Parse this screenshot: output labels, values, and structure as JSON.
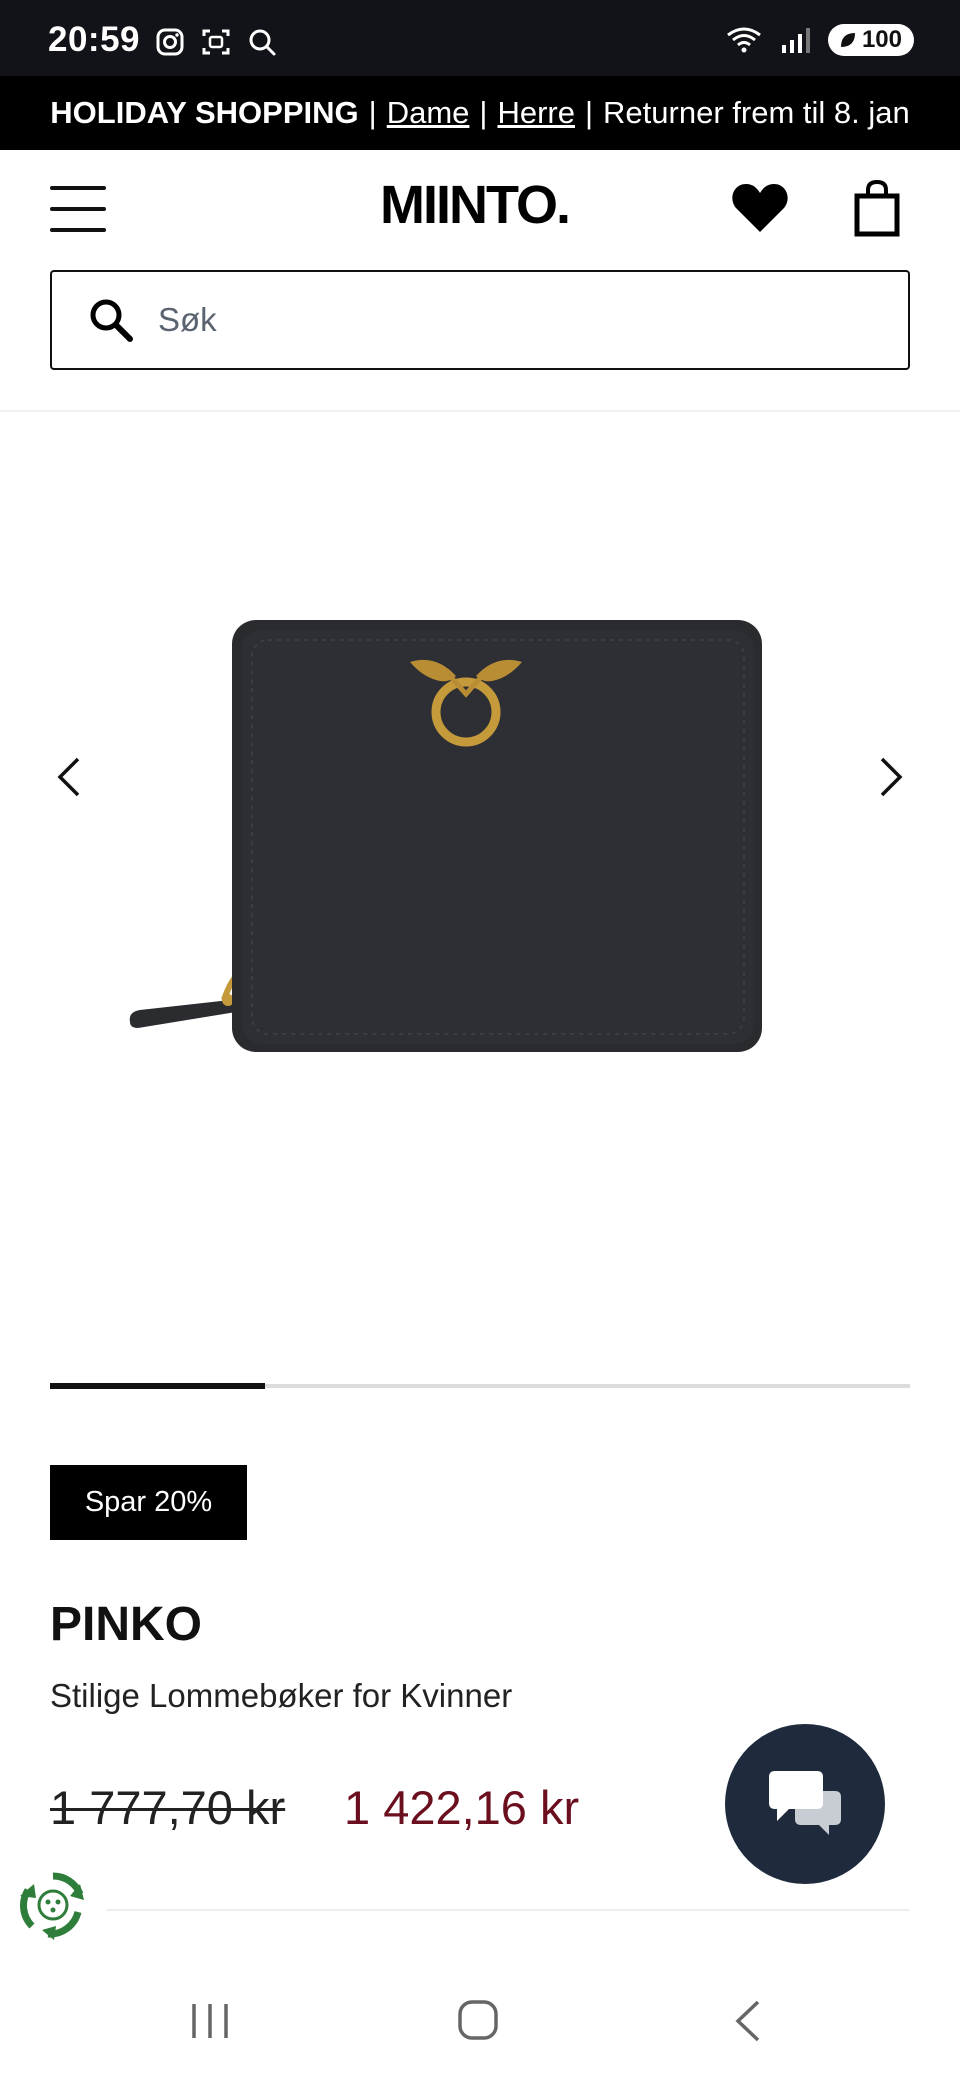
{
  "status_bar": {
    "time": "20:59",
    "left_icons": [
      "instagram-icon",
      "screenshot-icon",
      "search-icon"
    ],
    "right_icons": [
      "wifi-icon",
      "signal-icon"
    ],
    "battery": "100"
  },
  "promo": {
    "headline": "HOLIDAY SHOPPING",
    "link_women": "Dame",
    "link_men": "Herre",
    "returns": "Returner frem til 8. jan",
    "separator": "|"
  },
  "header": {
    "logo": "MIINTO.",
    "menu_icon": "hamburger-menu-icon",
    "wishlist_icon": "heart-icon",
    "cart_icon": "shopping-bag-icon"
  },
  "search": {
    "placeholder": "Søk",
    "value": ""
  },
  "carousel": {
    "current_slide": 1,
    "total_slides": 4,
    "prev_icon": "chevron-left-icon",
    "next_icon": "chevron-right-icon"
  },
  "product": {
    "badge": "Spar 20%",
    "brand": "PINKO",
    "title": "Stilige Lommebøker for Kvinner",
    "price_old": "1 777,70 kr",
    "price_new": "1 422,16 kr"
  },
  "colors": {
    "promo_bg": "#000000",
    "sale_price": "#6b0f1f",
    "chat_bg": "#1f2a3c",
    "status_bg": "#111318"
  },
  "floating": {
    "chat_icon": "chat-bubbles-icon",
    "eco_icon": "recycle-badge-icon"
  },
  "nav_bar": {
    "recents_icon": "recents-icon",
    "home_icon": "home-icon",
    "back_icon": "back-icon"
  }
}
